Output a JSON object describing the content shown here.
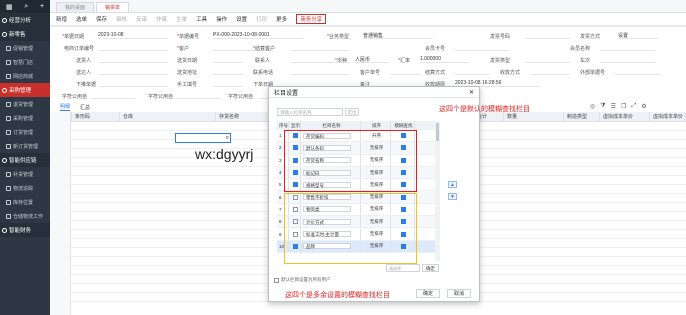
{
  "sidebar": {
    "top_icons": [
      "grid-icon",
      "search-icon",
      "plus-icon"
    ],
    "items": [
      {
        "label": "经营分析",
        "type": "group"
      },
      {
        "label": "新零售",
        "type": "group"
      },
      {
        "label": "促销管理",
        "type": "item"
      },
      {
        "label": "智慧门店",
        "type": "item"
      },
      {
        "label": "网店商城",
        "type": "item"
      },
      {
        "label": "采购管理",
        "type": "group",
        "active": true
      },
      {
        "label": "退货管理",
        "type": "item"
      },
      {
        "label": "采购管理",
        "type": "item"
      },
      {
        "label": "订货管理",
        "type": "item"
      },
      {
        "label": "新订货管理",
        "type": "item"
      },
      {
        "label": "智能供应链",
        "type": "group"
      },
      {
        "label": "补货管理",
        "type": "item"
      },
      {
        "label": "物流追踪",
        "type": "item"
      },
      {
        "label": "库存位置",
        "type": "item"
      },
      {
        "label": "仓储物流工作",
        "type": "item"
      },
      {
        "label": "智能财务",
        "type": "group"
      }
    ]
  },
  "top_tabs": [
    "我的桌面",
    "销货单"
  ],
  "toolbar": [
    "新增",
    "选单",
    "保存",
    "审核",
    "反审",
    "作废",
    "生单",
    "工具",
    "操作",
    "设置",
    "打印",
    "更多",
    "商务分享"
  ],
  "form": {
    "row1": [
      "单据日期",
      "2023-10-08",
      "单据编号",
      "PX-000-2023-10-08-0001",
      "业务类型",
      "普通销售",
      "发票号码",
      "发票方式",
      "设置"
    ],
    "row2": [
      "电商订单编号",
      "客户",
      "结算客户",
      "会员卡号",
      "会员名称"
    ],
    "row3": [
      "送货人",
      "送货日期",
      "联系人",
      "币种",
      "人民币",
      "汇率",
      "1.000000",
      "发票类型",
      "车次"
    ],
    "row4": [
      "送达人",
      "送货地址",
      "联系电话",
      "客户单号",
      "结算方式",
      "收款方式",
      "外部单据号"
    ],
    "row5": [
      "下推单据",
      "手工填号",
      "下单日期",
      "备注",
      "收款期限",
      "2023-10-08 16:28:56"
    ],
    "row6": [
      "字符公用自",
      "字符公用自",
      "字符公用自"
    ]
  },
  "subtabs": [
    "明细",
    "汇总"
  ],
  "grid_headers": [
    "序号",
    "条形码",
    "仓库",
    "存货名称",
    "规格型号",
    "主计量",
    "数量",
    "含税单价",
    "含税金额",
    "价税合计",
    "数量",
    "制造类型",
    "虚拟成本单价",
    "虚拟成本单价"
  ],
  "cell_text": "wx:dgyyrj",
  "modal": {
    "title": "栏目设置",
    "search_placeholder": "请输入栏目名称",
    "search_btn": "定位",
    "headers": [
      "序号",
      "显示",
      "栏目名称",
      "排序",
      "模糊查找"
    ],
    "rows": [
      {
        "n": "1",
        "show": true,
        "name": "存货编码",
        "sort": "升序",
        "fuzzy": true
      },
      {
        "n": "2",
        "show": true,
        "name": "默认条码",
        "sort": "无排序",
        "fuzzy": true
      },
      {
        "n": "3",
        "show": true,
        "name": "存货名称",
        "sort": "无排序",
        "fuzzy": true
      },
      {
        "n": "4",
        "show": true,
        "name": "助记码",
        "sort": "无排序",
        "fuzzy": true
      },
      {
        "n": "5",
        "show": true,
        "name": "规格型号",
        "sort": "无排序",
        "fuzzy": true
      },
      {
        "n": "6",
        "show": false,
        "name": "零售不折扣",
        "sort": "无排序",
        "fuzzy": true
      },
      {
        "n": "7",
        "show": false,
        "name": "物资类",
        "sort": "无排序",
        "fuzzy": true
      },
      {
        "n": "8",
        "show": false,
        "name": "计价方式",
        "sort": "无排序",
        "fuzzy": true
      },
      {
        "n": "9",
        "show": false,
        "name": "标准工时-主计量",
        "sort": "无排序",
        "fuzzy": true
      },
      {
        "n": "10",
        "show": true,
        "name": "品牌",
        "sort": "无排序",
        "fuzzy": true
      }
    ],
    "bottom_placeholder": "请选择",
    "bottom_btn": "确定",
    "hint": "默认栏目设置为所有用户",
    "ok": "确定",
    "cancel": "取消",
    "annot_top": "这四个是默认的模糊查找栏目",
    "annot_bottom": "这四个是多余设置的模糊查找栏目"
  }
}
